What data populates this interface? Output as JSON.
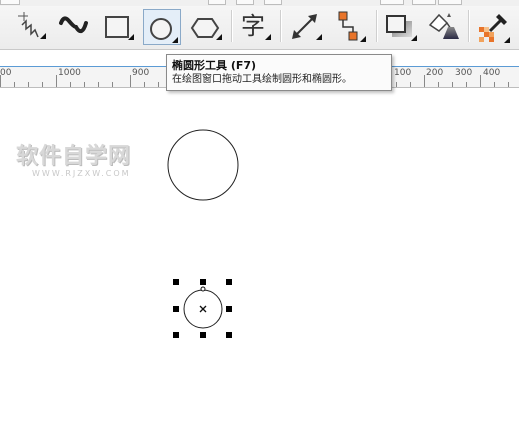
{
  "tooltip": {
    "title": "椭圆形工具 (F7)",
    "description": "在绘图窗口拖动工具绘制圆形和椭圆形。"
  },
  "toolbar": {
    "tools": [
      {
        "name": "freehand-tool",
        "icon": "freehand-icon"
      },
      {
        "name": "artistic-media-tool",
        "icon": "artistic-media-icon"
      },
      {
        "name": "rectangle-tool",
        "icon": "rectangle-icon"
      },
      {
        "name": "ellipse-tool",
        "icon": "ellipse-icon",
        "active": true
      },
      {
        "name": "polygon-tool",
        "icon": "polygon-icon"
      },
      {
        "name": "text-tool",
        "icon": "text-icon",
        "label": "字"
      },
      {
        "name": "dimension-tool",
        "icon": "dimension-icon"
      },
      {
        "name": "connector-tool",
        "icon": "connector-icon"
      },
      {
        "name": "drop-shadow-tool",
        "icon": "drop-shadow-icon"
      },
      {
        "name": "fill-tool",
        "icon": "fill-bucket-icon"
      },
      {
        "name": "eyedropper-tool",
        "icon": "eyedropper-icon"
      }
    ]
  },
  "ruler": {
    "labels": [
      "00",
      "1000",
      "900",
      "100",
      "200",
      "300",
      "400"
    ]
  },
  "watermark": {
    "main": "软件自学网",
    "sub": "WWW.RJZXW.COM"
  },
  "colors": {
    "accent_orange": "#e8742a",
    "active_tool_bg": "#e4eef8",
    "ruler_line": "#5b9bd5"
  }
}
